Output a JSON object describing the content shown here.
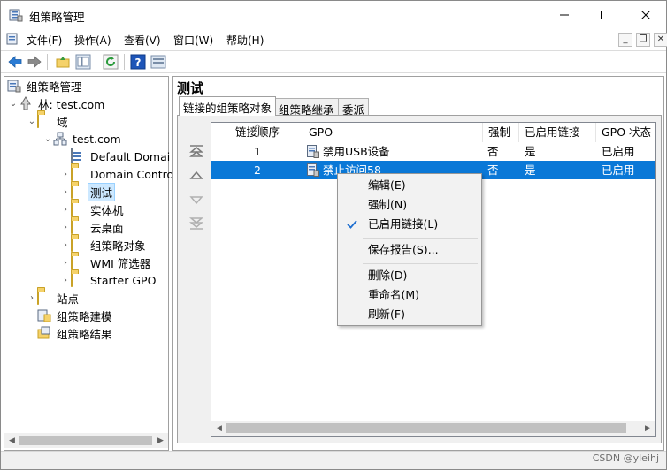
{
  "window": {
    "title": "组策略管理",
    "controls": [
      "minimize",
      "maximize",
      "close"
    ]
  },
  "menubar": {
    "items": [
      "文件(F)",
      "操作(A)",
      "查看(V)",
      "窗口(W)",
      "帮助(H)"
    ]
  },
  "toolbar": {
    "buttons": [
      "back-icon",
      "forward-icon",
      "up-folder-icon",
      "show-hide-tree-icon",
      "refresh-icon",
      "help-icon",
      "console-icon"
    ]
  },
  "tree": {
    "root": "组策略管理",
    "forest": "林: test.com",
    "domains": "域",
    "domain": "test.com",
    "children": [
      "Default Domai",
      "Domain Contro",
      "测试",
      "实体机",
      "云桌面",
      "组策略对象",
      "WMI 筛选器",
      "Starter GPO"
    ],
    "sites": "站点",
    "modeling": "组策略建模",
    "results": "组策略结果",
    "selected": "测试"
  },
  "detail": {
    "title": "测试",
    "tabs": [
      "链接的组策略对象",
      "组策略继承",
      "委派"
    ],
    "active_tab": "链接的组策略对象",
    "columns": [
      "链接顺序",
      "GPO",
      "强制",
      "已启用链接",
      "GPO 状态"
    ],
    "rows": [
      {
        "order": "1",
        "gpo": "禁用USB设备",
        "enforced": "否",
        "link_enabled": "是",
        "status": "已启用"
      },
      {
        "order": "2",
        "gpo": "禁止访问58",
        "enforced": "否",
        "link_enabled": "是",
        "status": "已启用"
      }
    ],
    "selected_row": 2
  },
  "context_menu": {
    "items": [
      "编辑(E)",
      "强制(N)",
      "已启用链接(L)",
      "保存报告(S)...",
      "删除(D)",
      "重命名(M)",
      "刷新(F)"
    ],
    "checked_item": "已启用链接(L)"
  },
  "status": {
    "watermark": "CSDN @yleihj"
  },
  "colors": {
    "selection": "#0a78d7",
    "tree_selection": "#cce8ff",
    "accent_blue": "#1e6fd0"
  }
}
